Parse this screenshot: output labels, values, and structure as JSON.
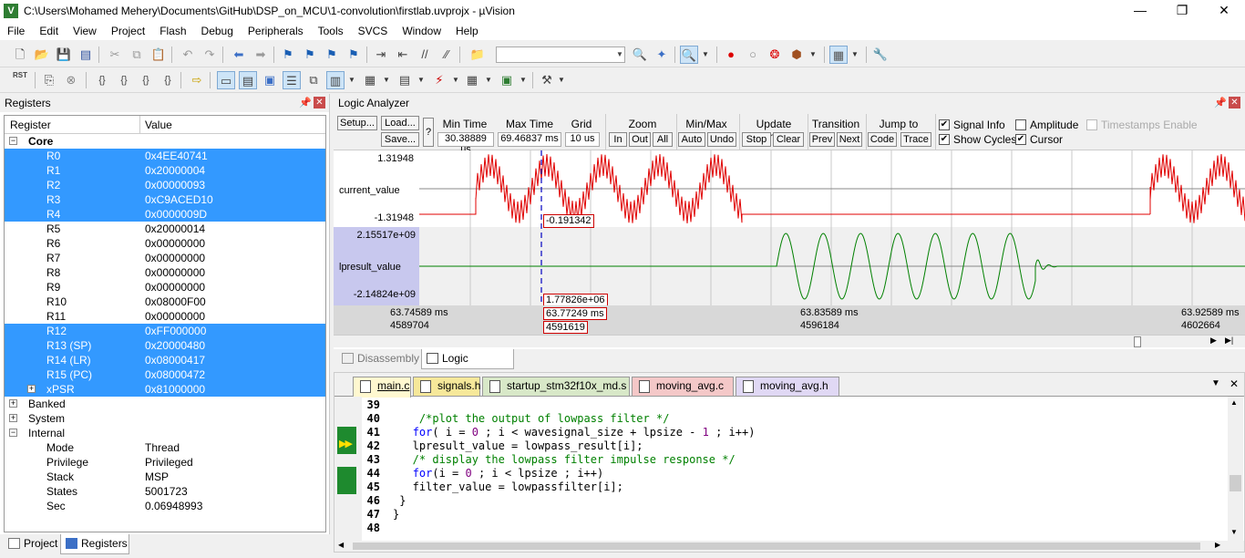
{
  "window": {
    "title": "C:\\Users\\Mohamed Mehery\\Documents\\GitHub\\DSP_on_MCU\\1-convolution\\firstlab.uvprojx - µVision",
    "app_icon": "V",
    "minimize": "—",
    "restore": "❐",
    "close": "✕"
  },
  "menu": [
    "File",
    "Edit",
    "View",
    "Project",
    "Flash",
    "Debug",
    "Peripherals",
    "Tools",
    "SVCS",
    "Window",
    "Help"
  ],
  "toolbar2": {
    "rst_label": "RST"
  },
  "registers_pane": {
    "title": "Registers",
    "col_register": "Register",
    "col_value": "Value",
    "core_label": "Core",
    "core_regs": [
      {
        "name": "R0",
        "value": "0x4EE40741"
      },
      {
        "name": "R1",
        "value": "0x20000004"
      },
      {
        "name": "R2",
        "value": "0x00000093"
      },
      {
        "name": "R3",
        "value": "0xC9ACED10"
      },
      {
        "name": "R4",
        "value": "0x0000009D"
      },
      {
        "name": "R5",
        "value": "0x20000014"
      },
      {
        "name": "R6",
        "value": "0x00000000"
      },
      {
        "name": "R7",
        "value": "0x00000000"
      },
      {
        "name": "R8",
        "value": "0x00000000"
      },
      {
        "name": "R9",
        "value": "0x00000000"
      },
      {
        "name": "R10",
        "value": "0x08000F00"
      },
      {
        "name": "R11",
        "value": "0x00000000"
      },
      {
        "name": "R12",
        "value": "0xFF000000"
      },
      {
        "name": "R13 (SP)",
        "value": "0x20000480"
      },
      {
        "name": "R14 (LR)",
        "value": "0x08000417"
      },
      {
        "name": "R15 (PC)",
        "value": "0x08000472"
      },
      {
        "name": "xPSR",
        "value": "0x81000000"
      }
    ],
    "groups": [
      "Banked",
      "System",
      "Internal"
    ],
    "internal": [
      {
        "name": "Mode",
        "value": "Thread"
      },
      {
        "name": "Privilege",
        "value": "Privileged"
      },
      {
        "name": "Stack",
        "value": "MSP"
      },
      {
        "name": "States",
        "value": "5001723"
      },
      {
        "name": "Sec",
        "value": "0.06948993"
      }
    ],
    "tab_project": "Project",
    "tab_registers": "Registers"
  },
  "logic_analyzer": {
    "title": "Logic Analyzer",
    "setup": "Setup...",
    "load": "Load...",
    "save": "Save...",
    "help": "?",
    "min_time_label": "Min Time",
    "min_time": "30.38889 us",
    "max_time_label": "Max Time",
    "max_time": "69.46837 ms",
    "grid_label": "Grid",
    "grid": "10 us",
    "zoom_label": "Zoom",
    "zoom_in": "In",
    "zoom_out": "Out",
    "zoom_all": "All",
    "minmax_label": "Min/Max",
    "auto": "Auto",
    "undo": "Undo",
    "update_label": "Update Screen",
    "stop": "Stop",
    "clear": "Clear",
    "transition_label": "Transition",
    "prev": "Prev",
    "next": "Next",
    "jump_label": "Jump to",
    "code": "Code",
    "trace": "Trace",
    "signal_info": "Signal Info",
    "amplitude": "Amplitude",
    "timestamps": "Timestamps Enable",
    "show_cycles": "Show Cycles",
    "cursor": "Cursor",
    "signal1": {
      "name": "current_value",
      "max": "1.31948",
      "min": "-1.31948",
      "cursor_val": "-0.191342",
      "color": "#e00000"
    },
    "signal2": {
      "name": "lpresult_value",
      "max": "2.15517e+09",
      "min": "-2.14824e+09",
      "cursor_val": "1.77826e+06",
      "color": "#008000"
    },
    "time_left": "63.74589 ms",
    "cycles_left": "4589704",
    "time_cursor": "63.77249 ms",
    "cycles_cursor": "4591619",
    "time_mid": "63.83589 ms",
    "cycles_mid": "4596184",
    "time_right": "63.92589 ms",
    "cycles_right": "4602664"
  },
  "mid_tabs": {
    "disassembly": "Disassembly",
    "logic_analyzer": "Logic Analyzer"
  },
  "editor": {
    "tabs": [
      {
        "name": "main.c",
        "color": "#fff8d0"
      },
      {
        "name": "signals.h",
        "color": "#f6e89a"
      },
      {
        "name": "startup_stm32f10x_md.s",
        "color": "#d8e8c8"
      },
      {
        "name": "moving_avg.c",
        "color": "#f4c8c8"
      },
      {
        "name": "moving_avg.h",
        "color": "#e0d8f4"
      }
    ],
    "tab_menu": "▼",
    "tab_close": "✕",
    "lines": [
      {
        "n": "39",
        "t": ""
      },
      {
        "n": "40",
        "t": "    /*plot the output of lowpass filter */"
      },
      {
        "n": "41",
        "t": "   for( i = 0 ; i < wavesignal_size + lpsize - 1 ; i++)"
      },
      {
        "n": "42",
        "t": "   lpresult_value = lowpass_result[i];"
      },
      {
        "n": "43",
        "t": "   /* display the lowpass filter impulse response */"
      },
      {
        "n": "44",
        "t": "   for(i = 0 ; i < lpsize ; i++)"
      },
      {
        "n": "45",
        "t": "   filter_value = lowpassfilter[i];"
      },
      {
        "n": "46",
        "t": " }"
      },
      {
        "n": "47",
        "t": "}"
      },
      {
        "n": "48",
        "t": ""
      }
    ]
  }
}
